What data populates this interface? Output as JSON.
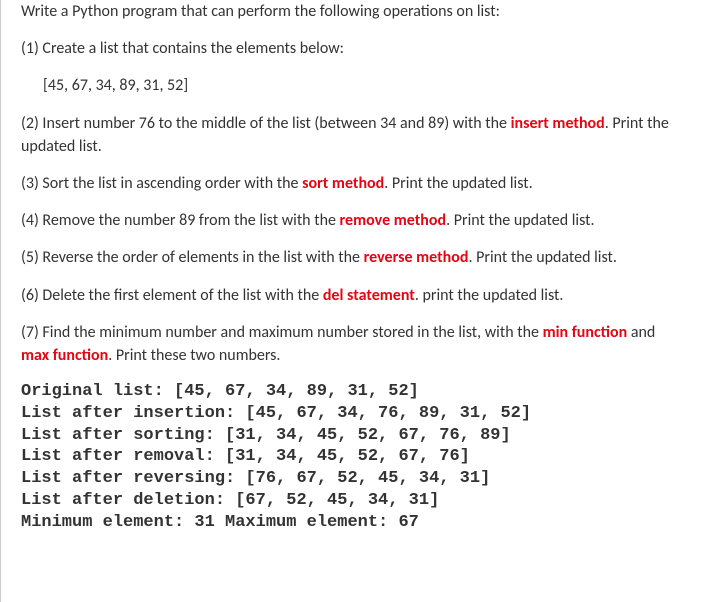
{
  "intro": "Write a Python program that can perform the following operations on list:",
  "step1_text": "(1) Create a list that contains the elements below:",
  "list_literal": "[45, 67, 34, 89, 31, 52]",
  "step2_a": "(2) Insert number 76 to the middle of the list (between 34 and 89) with the ",
  "step2_kw": "insert method",
  "step2_b": ". Print the updated list.",
  "step3_a": "(3) Sort the list in ascending order with the ",
  "step3_kw": "sort method",
  "step3_b": ". Print the updated list.",
  "step4_a": "(4) Remove the number 89 from the list with the ",
  "step4_kw": "remove method",
  "step4_b": ". Print the updated list.",
  "step5_a": "(5) Reverse the order of elements in the list with the ",
  "step5_kw": "reverse method",
  "step5_b": ". Print the updated list.",
  "step6_a": "(6) Delete the first element of the list with the ",
  "step6_kw": "del statement",
  "step6_b": ". print the updated list.",
  "step7_a": "(7) Find the minimum number and maximum number stored in the list, with the ",
  "step7_kw1": "min function",
  "step7_mid": " and ",
  "step7_kw2": "max function",
  "step7_b": ". Print these two numbers.",
  "out_line1": "Original list: [45, 67, 34, 89, 31, 52]",
  "out_line2": "List after insertion: [45, 67, 34, 76, 89, 31, 52]",
  "out_line3": "List after sorting: [31, 34, 45, 52, 67, 76, 89]",
  "out_line4": "List after removal: [31, 34, 45, 52, 67, 76]",
  "out_line5": "List after reversing: [76, 67, 52, 45, 34, 31]",
  "out_line6": "List after deletion: [67, 52, 45, 34, 31]",
  "out_line7": "Minimum element: 31 Maximum element: 67",
  "chart_data": {
    "type": "table",
    "original_list": [
      45,
      67,
      34,
      89,
      31,
      52
    ],
    "after_insertion": [
      45,
      67,
      34,
      76,
      89,
      31,
      52
    ],
    "after_sorting": [
      31,
      34,
      45,
      52,
      67,
      76,
      89
    ],
    "after_removal": [
      31,
      34,
      45,
      52,
      67,
      76
    ],
    "after_reversing": [
      76,
      67,
      52,
      45,
      34,
      31
    ],
    "after_deletion": [
      67,
      52,
      45,
      34,
      31
    ],
    "minimum": 31,
    "maximum": 67
  }
}
